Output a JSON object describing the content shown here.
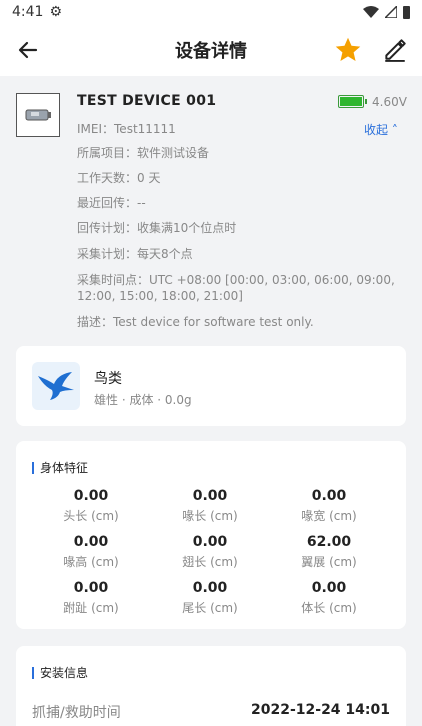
{
  "status_bar": {
    "time": "4:41"
  },
  "app_bar": {
    "title": "设备详情"
  },
  "device": {
    "name": "TEST DEVICE 001",
    "voltage": "4.60V",
    "collapse_label": "收起 ˄",
    "imei": "IMEI：Test11111",
    "project": "所属项目：软件测试设备",
    "working_days": "工作天数：0 天",
    "last_upload": "最近回传：--",
    "upload_plan": "回传计划：收集满10个位点时",
    "collect_plan": "采集计划：每天8个点",
    "collect_times": "采集时间点：UTC +08:00 [00:00, 03:00, 06:00, 09:00, 12:00, 15:00, 18:00, 21:00]",
    "description": "描述：Test device for software test only.",
    "colors": {
      "battery": "#2fb62f",
      "accent": "#2a6fdb"
    }
  },
  "species": {
    "name": "鸟类",
    "detail": "雄性 · 成体 · 0.0g"
  },
  "body": {
    "title": "身体特征",
    "cells": [
      {
        "value": "0.00",
        "label": "头长 (cm)"
      },
      {
        "value": "0.00",
        "label": "喙长 (cm)"
      },
      {
        "value": "0.00",
        "label": "喙宽 (cm)"
      },
      {
        "value": "0.00",
        "label": "喙高 (cm)"
      },
      {
        "value": "0.00",
        "label": "翅长 (cm)"
      },
      {
        "value": "62.00",
        "label": "翼展 (cm)"
      },
      {
        "value": "0.00",
        "label": "跗趾 (cm)"
      },
      {
        "value": "0.00",
        "label": "尾长 (cm)"
      },
      {
        "value": "0.00",
        "label": "体长 (cm)"
      }
    ]
  },
  "install": {
    "title": "安装信息",
    "capture_label": "抓捕/救助时间",
    "capture_value": "2022-12-24 14:01"
  }
}
